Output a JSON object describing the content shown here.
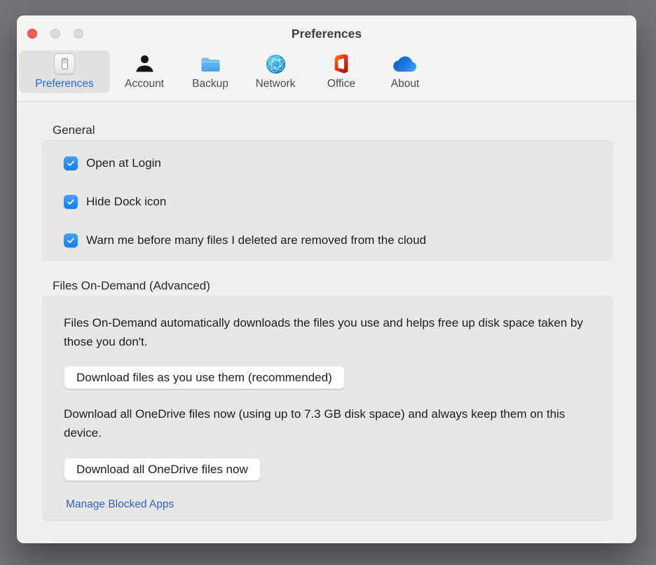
{
  "window": {
    "title": "Preferences"
  },
  "traffic_lights": {
    "close_color": "#fb5d54",
    "minimize_color": "#dcdbda",
    "zoom_color": "#dcdbda"
  },
  "toolbar": {
    "tabs": [
      {
        "label": "Preferences",
        "icon": "switch-icon",
        "selected": true
      },
      {
        "label": "Account",
        "icon": "person-icon",
        "selected": false
      },
      {
        "label": "Backup",
        "icon": "folder-icon",
        "selected": false
      },
      {
        "label": "Network",
        "icon": "globe-icon",
        "selected": false
      },
      {
        "label": "Office",
        "icon": "office-logo-icon",
        "selected": false
      },
      {
        "label": "About",
        "icon": "onedrive-cloud-icon",
        "selected": false
      }
    ]
  },
  "general": {
    "heading": "General",
    "checkboxes": [
      {
        "label": "Open at Login",
        "checked": true
      },
      {
        "label": "Hide Dock icon",
        "checked": true
      },
      {
        "label": "Warn me before many files I deleted are removed from the cloud",
        "checked": true
      }
    ]
  },
  "files_on_demand": {
    "heading": "Files On-Demand (Advanced)",
    "description": "Files On-Demand automatically downloads the files you use and helps free up disk space taken by those you don't.",
    "download_as_used_button": "Download files as you use them (recommended)",
    "download_all_description": "Download all OneDrive files now (using up to 7.3 GB disk space) and always keep them on this device.",
    "download_all_button": "Download all OneDrive files now",
    "manage_blocked_apps_link": "Manage Blocked Apps"
  },
  "colors": {
    "desktop_background": "#757379",
    "window_background": "#f0efee",
    "toolbar_background": "#f6f5f4",
    "group_box_background": "#e9e7e5",
    "selected_tab_background": "#e4e2e0",
    "accent_blue": "#2468f0",
    "checkbox_blue": "#0d7ef7",
    "link_blue": "#2c62c9",
    "close_button_red": "#fb5d54"
  }
}
